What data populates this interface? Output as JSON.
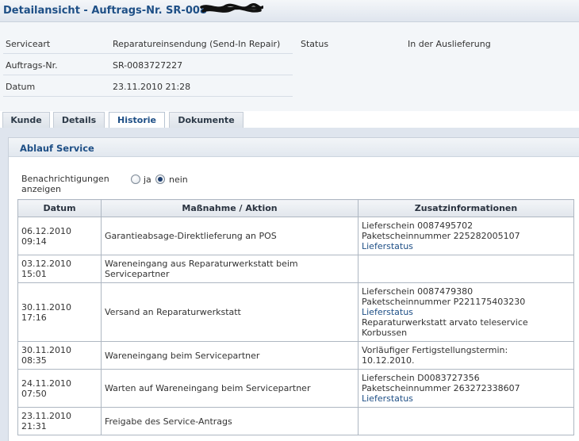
{
  "title": "Detailansicht - Auftrags-Nr. SR-008",
  "header": {
    "serviceart_label": "Serviceart",
    "serviceart_value": "Reparatureinsendung (Send-In Repair)",
    "status_label": "Status",
    "status_value": "In der Auslieferung",
    "auftrag_label": "Auftrags-Nr.",
    "auftrag_value": "SR-0083727227",
    "datum_label": "Datum",
    "datum_value": "23.11.2010 21:28"
  },
  "tabs": [
    {
      "label": "Kunde"
    },
    {
      "label": "Details"
    },
    {
      "label": "Historie"
    },
    {
      "label": "Dokumente"
    }
  ],
  "section": {
    "title": "Ablauf Service",
    "notify_label": "Benachrichtigungen anzeigen",
    "radio_yes": "ja",
    "radio_no": "nein",
    "selected": "nein"
  },
  "table": {
    "headers": [
      "Datum",
      "Maßnahme / Aktion",
      "Zusatzinformationen"
    ],
    "rows": [
      {
        "date": "06.12.2010",
        "time": "09:14",
        "action": "Garantieabsage-Direktlieferung an POS",
        "info": [
          "Lieferschein 0087495702",
          "Paketscheinnummer 225282005107"
        ],
        "link": "Lieferstatus"
      },
      {
        "date": "03.12.2010",
        "time": "15:01",
        "action": "Wareneingang aus Reparaturwerkstatt beim Servicepartner",
        "info": [],
        "link": ""
      },
      {
        "date": "30.11.2010",
        "time": "17:16",
        "action": "Versand an Reparaturwerkstatt",
        "info": [
          "Lieferschein 0087479380",
          "Paketscheinnummer P221175403230"
        ],
        "link": "Lieferstatus",
        "info_after": [
          "Reparaturwerkstatt arvato teleservice",
          "Korbussen"
        ]
      },
      {
        "date": "30.11.2010",
        "time": "08:35",
        "action": "Wareneingang beim Servicepartner",
        "info": [
          "Vorläufiger Fertigstellungstermin:",
          "10.12.2010."
        ],
        "link": ""
      },
      {
        "date": "24.11.2010",
        "time": "07:50",
        "action": "Warten auf Wareneingang beim Servicepartner",
        "info": [
          "Lieferschein D0083727356",
          "Paketscheinnummer 263272338607"
        ],
        "link": "Lieferstatus"
      },
      {
        "date": "23.11.2010",
        "time": "21:31",
        "action": "Freigabe des Service-Antrags",
        "info": [],
        "link": ""
      }
    ]
  }
}
